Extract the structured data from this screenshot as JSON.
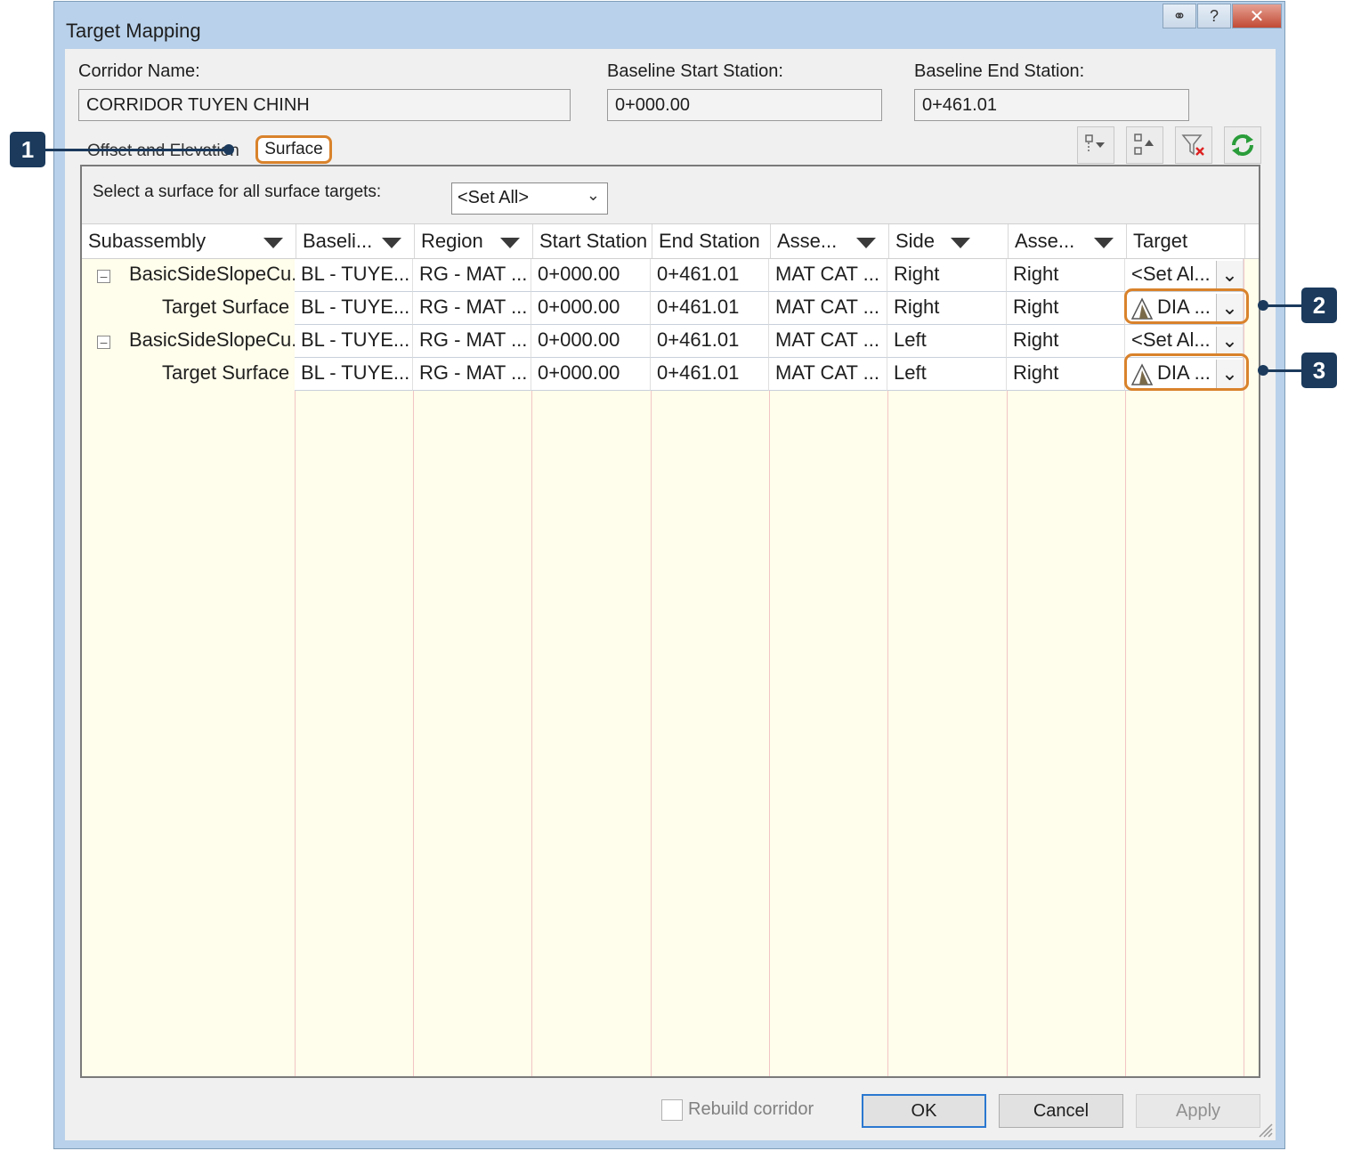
{
  "window": {
    "title": "Target Mapping",
    "help_icon": "help-icon",
    "close_icon": "close-icon",
    "pin_icon": "pin-icon"
  },
  "fields": {
    "corridor_name_label": "Corridor Name:",
    "corridor_name_value": "CORRIDOR TUYEN CHINH",
    "start_station_label": "Baseline Start Station:",
    "start_station_value": "0+000.00",
    "end_station_label": "Baseline End Station:",
    "end_station_value": "0+461.01"
  },
  "tabs": [
    {
      "label": "Offset and Elevation",
      "active": false
    },
    {
      "label": "Surface",
      "active": true
    }
  ],
  "toolbar": {
    "icons": [
      "group-by-icon",
      "sort-icon",
      "clear-filter-icon",
      "refresh-icon"
    ]
  },
  "surface_select": {
    "label": "Select a surface for all surface targets:",
    "value": "<Set All>"
  },
  "grid": {
    "columns": [
      "Subassembly",
      "Baseli...",
      "Region",
      "Start Station",
      "End Station",
      "Asse...",
      "Side",
      "Asse...",
      "Target"
    ],
    "rows": [
      {
        "level": 0,
        "name": "BasicSideSlopeCu...",
        "baseline": "BL - TUYE...",
        "region": "RG - MAT ...",
        "start": "0+000.00",
        "end": "0+461.01",
        "assembly": "MAT CAT ...",
        "side": "Right",
        "assembly_side": "Right",
        "target": "<Set Al..."
      },
      {
        "level": 1,
        "name": "Target Surface",
        "baseline": "BL - TUYE...",
        "region": "RG - MAT ...",
        "start": "0+000.00",
        "end": "0+461.01",
        "assembly": "MAT CAT ...",
        "side": "Right",
        "assembly_side": "Right",
        "target": "DIA ..."
      },
      {
        "level": 0,
        "name": "BasicSideSlopeCu...",
        "baseline": "BL - TUYE...",
        "region": "RG - MAT ...",
        "start": "0+000.00",
        "end": "0+461.01",
        "assembly": "MAT CAT ...",
        "side": "Left",
        "assembly_side": "Right",
        "target": "<Set Al..."
      },
      {
        "level": 1,
        "name": "Target Surface",
        "baseline": "BL - TUYE...",
        "region": "RG - MAT ...",
        "start": "0+000.00",
        "end": "0+461.01",
        "assembly": "MAT CAT ...",
        "side": "Left",
        "assembly_side": "Right",
        "target": "DIA ..."
      }
    ]
  },
  "footer": {
    "rebuild_label": "Rebuild corridor",
    "ok_label": "OK",
    "cancel_label": "Cancel",
    "apply_label": "Apply"
  },
  "callouts": [
    "1",
    "2",
    "3"
  ],
  "colors": {
    "highlight": "#d9822b",
    "callout": "#1b3a5c",
    "grid_bg": "#fffdeb"
  }
}
